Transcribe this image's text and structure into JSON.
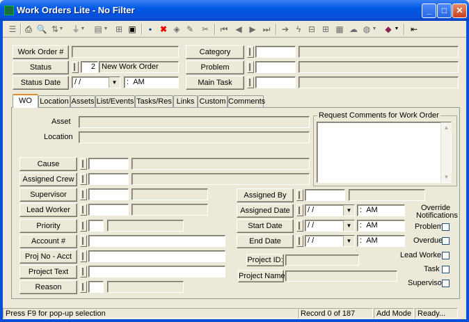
{
  "window": {
    "title": "Work Orders Lite - No Filter",
    "minimize": "_",
    "maximize": "□",
    "close": "✕"
  },
  "toolbar": {
    "icons": [
      "list-icon",
      "print-icon",
      "preview-icon",
      "sort-icon",
      "filter-icon",
      "form-icon",
      "query-icon",
      "export-icon",
      "save-icon",
      "delete-icon",
      "stamp-icon",
      "edit-icon",
      "cut-icon",
      "first-icon",
      "prev-icon",
      "next-icon",
      "last-icon",
      "goto-icon",
      "flash-icon",
      "tree-icon",
      "tree2-icon",
      "table-icon",
      "cloud-icon",
      "globe-icon",
      "book-icon",
      "exit-icon"
    ]
  },
  "header": {
    "work_order_label": "Work Order #",
    "work_order_value": "",
    "status_label": "Status",
    "status_code": "2",
    "status_text": "New Work Order",
    "status_date_label": "Status Date",
    "status_date_value": "/ /",
    "status_time_sep": ":",
    "status_time_ampm": "AM",
    "category_label": "Category",
    "problem_label": "Problem",
    "main_task_label": "Main Task"
  },
  "tabs": [
    {
      "label": "WO",
      "active": true
    },
    {
      "label": "Location"
    },
    {
      "label": "Assets"
    },
    {
      "label": "List/Events"
    },
    {
      "label": "Tasks/Res"
    },
    {
      "label": "Links"
    },
    {
      "label": "Custom"
    },
    {
      "label": "Comments"
    }
  ],
  "wo": {
    "asset_label": "Asset",
    "location_label": "Location",
    "request_comments_title": "Request Comments for Work Order",
    "cause_label": "Cause",
    "assigned_crew_label": "Assigned Crew",
    "supervisor_label": "Supervisor",
    "lead_worker_label": "Lead Worker",
    "priority_label": "Priority",
    "account_label": "Account #",
    "proj_no_label": "Proj No - Acct",
    "project_text_label": "Project Text",
    "reason_label": "Reason",
    "assigned_by_label": "Assigned By",
    "assigned_date_label": "Assigned Date",
    "start_date_label": "Start Date",
    "end_date_label": "End Date",
    "date_value": "/ /",
    "time_sep": ":",
    "time_ampm": "AM",
    "project_id_label": "Project ID:",
    "project_name_label": "Project Name:",
    "override_title_1": "Override",
    "override_title_2": "Notifications",
    "override_problem": "Problem",
    "override_overdue": "Overdue",
    "override_lead_worker": "Lead Worker",
    "override_task": "Task",
    "override_supervisor": "Supervisor"
  },
  "status_bar": {
    "hint": "Press F9 for pop-up selection",
    "record": "Record 0 of 187",
    "mode": "Add Mode",
    "state": "Ready..."
  },
  "colors": {
    "titlebar": "#0a4fd8",
    "face": "#ece9d8",
    "tab_highlight": "#e68b2c"
  }
}
